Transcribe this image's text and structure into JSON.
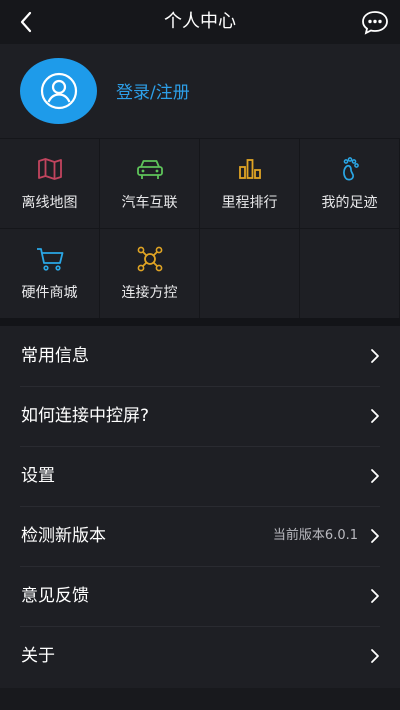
{
  "header": {
    "title": "个人中心",
    "back_icon": "back-chevron-icon",
    "more_icon": "more-dots-icon"
  },
  "profile": {
    "avatar_icon": "user-avatar-icon",
    "login_label": "登录/注册",
    "accent_color": "#2d9fe8",
    "avatar_color": "#1e9bea"
  },
  "features": [
    {
      "label": "离线地图",
      "icon": "map-icon",
      "color": "#c2445e"
    },
    {
      "label": "汽车互联",
      "icon": "car-icon",
      "color": "#5ec45a"
    },
    {
      "label": "里程排行",
      "icon": "bar-chart-icon",
      "color": "#e0a424"
    },
    {
      "label": "我的足迹",
      "icon": "footprint-icon",
      "color": "#2aa7e6"
    },
    {
      "label": "硬件商城",
      "icon": "cart-icon",
      "color": "#2aa7e6"
    },
    {
      "label": "连接方控",
      "icon": "controller-icon",
      "color": "#e0a424"
    }
  ],
  "menu": [
    {
      "label": "常用信息",
      "value": ""
    },
    {
      "label": "如何连接中控屏?",
      "value": ""
    },
    {
      "label": "设置",
      "value": ""
    },
    {
      "label": "检测新版本",
      "value": "当前版本6.0.1"
    },
    {
      "label": "意见反馈",
      "value": ""
    },
    {
      "label": "关于",
      "value": ""
    }
  ]
}
